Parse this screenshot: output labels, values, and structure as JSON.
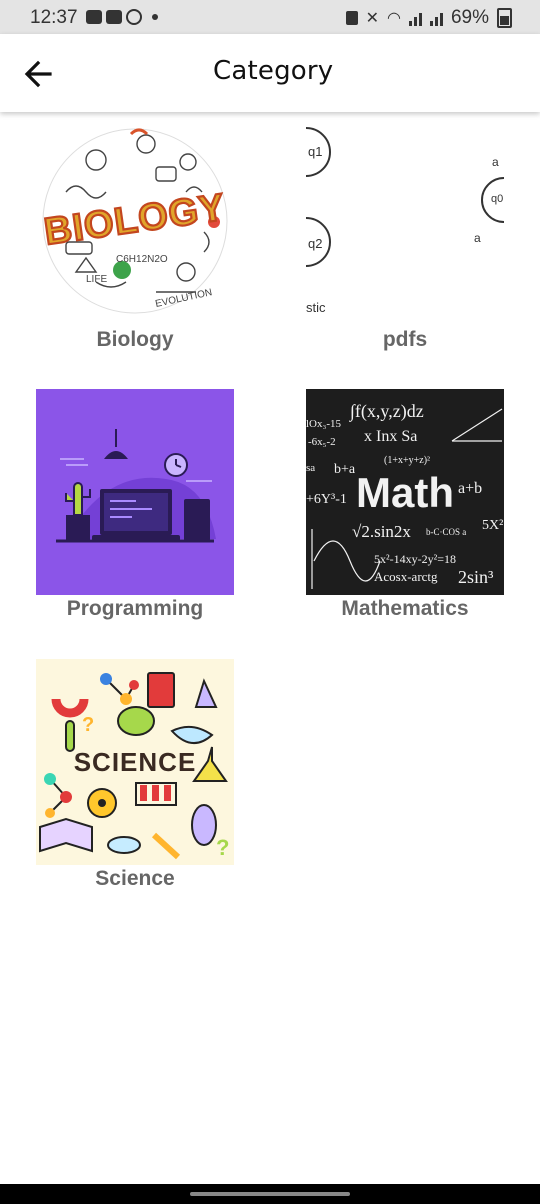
{
  "status_bar": {
    "time": "12:37",
    "battery": "69%"
  },
  "app_bar": {
    "title": "Category"
  },
  "categories": [
    {
      "label": "Biology",
      "icon": "biology-image"
    },
    {
      "label": "pdfs",
      "icon": "pdfs-image"
    },
    {
      "label": "Programming",
      "icon": "programming-image"
    },
    {
      "label": "Mathematics",
      "icon": "mathematics-image"
    },
    {
      "label": "Science",
      "icon": "science-image"
    }
  ],
  "colors": {
    "programming_bg": "#8b55e8",
    "math_bg": "#1d1d1d",
    "science_bg": "#fdf7de",
    "label": "#666666"
  }
}
